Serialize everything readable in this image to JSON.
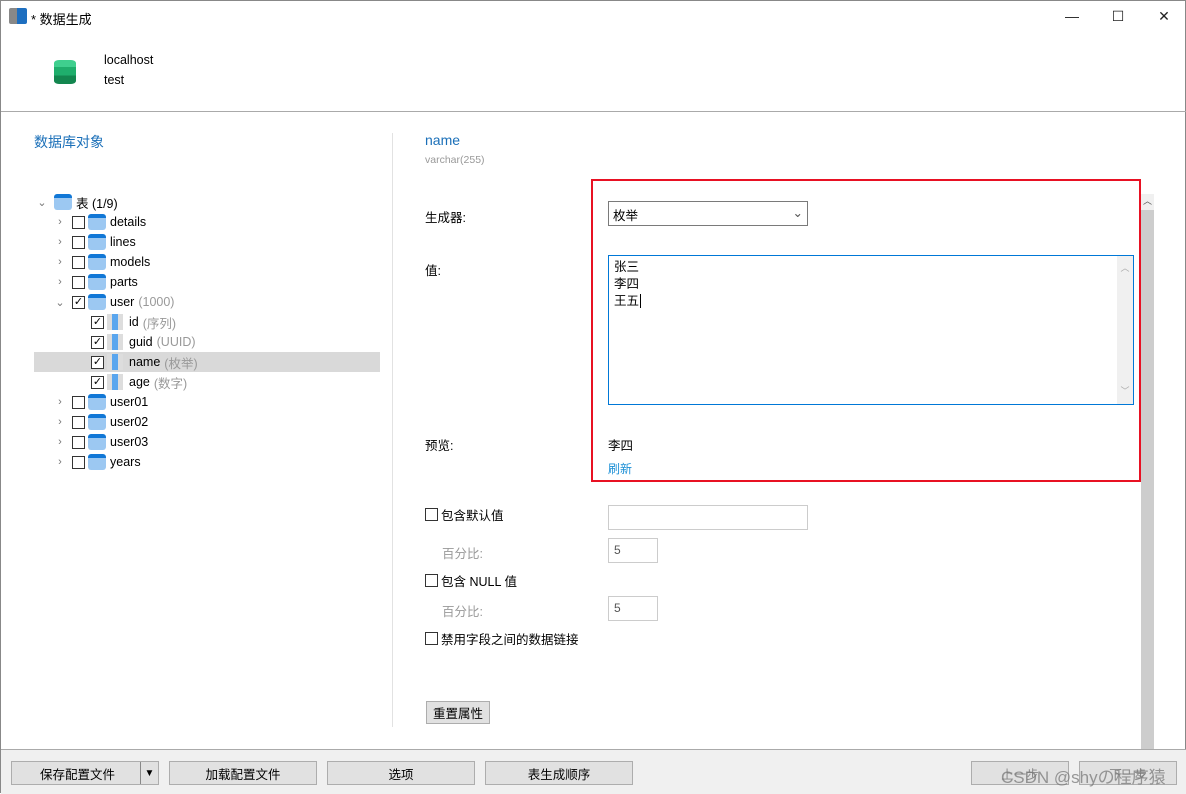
{
  "window": {
    "title": "* 数据生成",
    "min": "—",
    "max": "☐",
    "close": "✕"
  },
  "connection": {
    "host": "localhost",
    "database": "test"
  },
  "left": {
    "section_title": "数据库对象",
    "root": {
      "label": "表 (1/9)"
    },
    "tables": [
      {
        "name": "details",
        "checked": false
      },
      {
        "name": "lines",
        "checked": false
      },
      {
        "name": "models",
        "checked": false
      },
      {
        "name": "parts",
        "checked": false
      },
      {
        "name": "user",
        "checked": true,
        "extra": "(1000)",
        "expanded": true
      },
      {
        "name": "user01",
        "checked": false
      },
      {
        "name": "user02",
        "checked": false
      },
      {
        "name": "user03",
        "checked": false
      },
      {
        "name": "years",
        "checked": false
      }
    ],
    "columns": [
      {
        "name": "id",
        "extra": "(序列)"
      },
      {
        "name": "guid",
        "extra": "(UUID)"
      },
      {
        "name": "name",
        "extra": "(枚举)"
      },
      {
        "name": "age",
        "extra": "(数字)"
      }
    ]
  },
  "field": {
    "name": "name",
    "type": "varchar(255)",
    "generator_label": "生成器:",
    "generator_value": "枚举",
    "value_label": "值:",
    "values": [
      "张三",
      "李四",
      "王五"
    ],
    "preview_label": "预览:",
    "preview_value": "李四",
    "refresh": "刷新",
    "include_default": "包含默认值",
    "default_value": "",
    "percent_label": "百分比:",
    "default_percent": "5",
    "include_null": "包含 NULL 值",
    "null_percent": "5",
    "disable_link": "禁用字段之间的数据链接",
    "reset": "重置属性"
  },
  "footer": {
    "save": "保存配置文件",
    "load": "加载配置文件",
    "options": "选项",
    "order": "表生成顺序",
    "prev": "上一步",
    "next": "下一步",
    "watermark": "CSDN @shyの程序猿"
  }
}
